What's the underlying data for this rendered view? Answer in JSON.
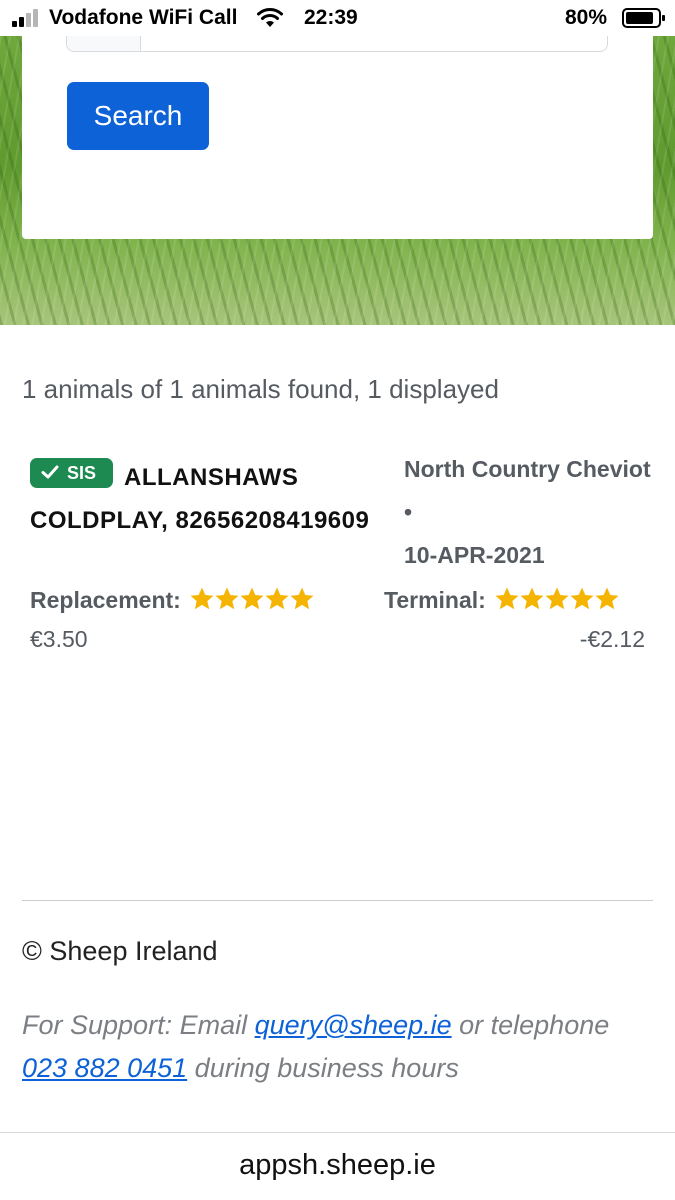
{
  "status_bar": {
    "carrier": "Vodafone WiFi Call",
    "time": "22:39",
    "battery": "80%"
  },
  "search": {
    "button_label": "Search"
  },
  "results": {
    "summary": "1 animals of 1 animals found, 1 displayed"
  },
  "animal": {
    "badge": "SIS",
    "name": "ALLANSHAWS COLDPLAY, 82656208419609",
    "breed": "North Country Cheviot",
    "dot": "•",
    "date": "10-APR-2021",
    "replacement_label": "Replacement:",
    "replacement_stars": 5,
    "replacement_value": "€3.50",
    "terminal_label": "Terminal:",
    "terminal_stars": 5,
    "terminal_value": "-€2.12"
  },
  "footer": {
    "copyright": "© Sheep Ireland",
    "support_prefix": "For Support: Email ",
    "support_email": "query@sheep.ie",
    "support_mid": " or telephone ",
    "support_phone": "023 882 0451",
    "support_suffix": " during business hours"
  },
  "browser": {
    "url": "appsh.sheep.ie"
  },
  "colors": {
    "primary": "#0d62d8",
    "badge": "#1d8a52",
    "star": "#f5b400"
  }
}
